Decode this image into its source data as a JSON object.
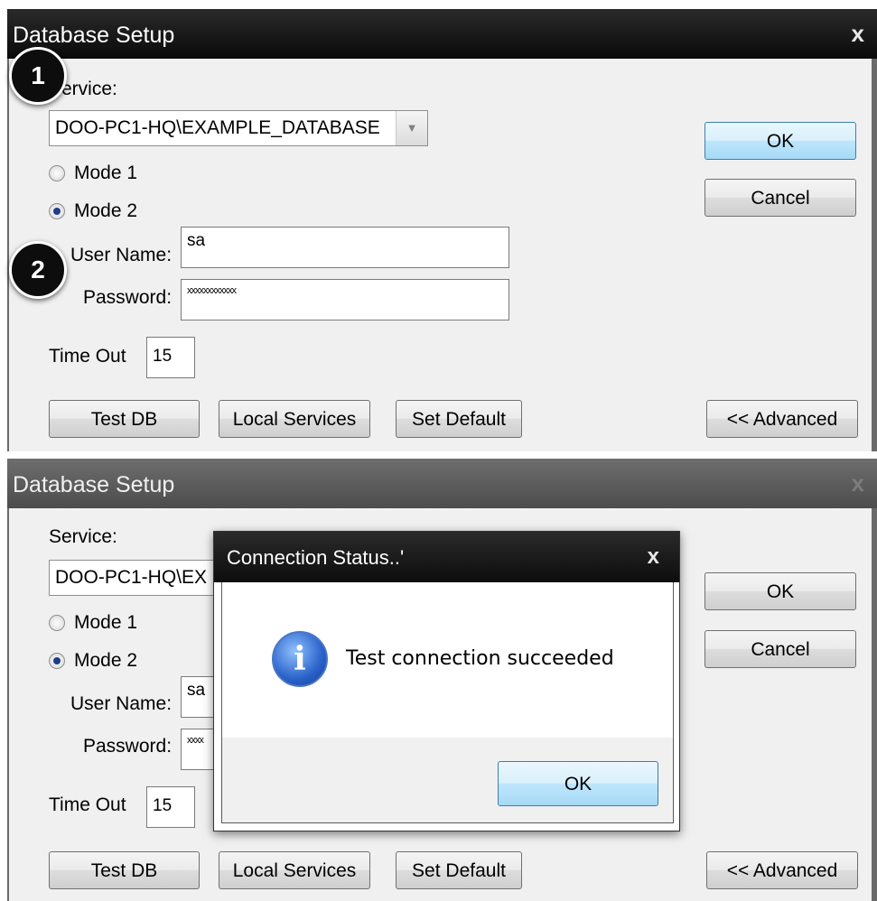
{
  "window": {
    "title": "Database Setup",
    "close": "x",
    "service_label": "Service:",
    "service_label_partial": "ervice:",
    "service_value": "DOO-PC1-HQ\\EXAMPLE_DATABASE",
    "service_value_clipped": "DOO-PC1-HQ\\EX",
    "mode1": "Mode 1",
    "mode2": "Mode 2",
    "selected_mode": "Mode 2",
    "username_label": "User Name:",
    "username_value": "sa",
    "password_label": "Password:",
    "password_value": "xxxxxxxxxxxx",
    "password_value_clipped": "xxxx",
    "timeout_label": "Time Out",
    "timeout_value": "15",
    "ok": "OK",
    "cancel": "Cancel",
    "test_db": "Test DB",
    "local_services": "Local Services",
    "set_default": "Set Default",
    "advanced": "<< Advanced"
  },
  "annotations": {
    "badge1": "1",
    "badge2": "2"
  },
  "dialog": {
    "title": "Connection Status..'",
    "close": "x",
    "icon": "info-icon",
    "message": "Test connection succeeded",
    "ok": "OK"
  }
}
